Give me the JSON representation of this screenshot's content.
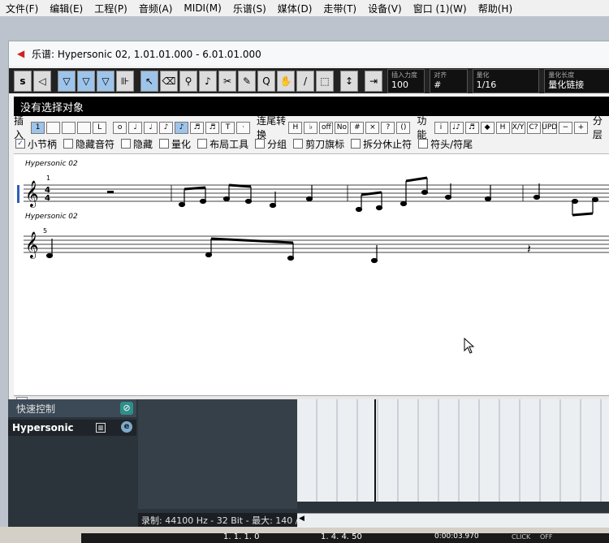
{
  "menubar": {
    "items": [
      "文件(F)",
      "编辑(E)",
      "工程(P)",
      "音频(A)",
      "MIDI(M)",
      "乐谱(S)",
      "媒体(D)",
      "走带(T)",
      "设备(V)",
      "窗口 (1)(W)",
      "帮助(H)"
    ]
  },
  "window": {
    "title": "乐谱: Hypersonic 02, 1.01.01.000 - 6.01.01.000"
  },
  "toolbar": {
    "insert_velocity_label": "插入力度",
    "insert_velocity_value": "100",
    "snap_label": "对齐",
    "quantize_label": "量化",
    "quantize_value": "1/16",
    "quantize_length_label": "量化长度",
    "quantize_length_value": "量化链接"
  },
  "status": {
    "text": "没有选择对象"
  },
  "insert_bar": {
    "insert_label": "插入",
    "insert_buttons": [
      "1",
      "",
      "",
      "",
      "L"
    ],
    "note_buttons": [
      "o",
      "♩",
      "♩",
      "♪",
      "♪",
      "♬",
      "♬",
      "T",
      "·"
    ],
    "beam_label": "连尾转换",
    "beam_buttons": [
      "H",
      "♭",
      "off",
      "No",
      "#",
      "×",
      "?",
      "()"
    ],
    "func_label": "功能",
    "func_buttons": [
      "i",
      "♩♪",
      "♬",
      "◆",
      "H",
      "X/Y",
      "C?",
      "UPD",
      "−",
      "+"
    ],
    "split_label": "分层"
  },
  "filters": [
    {
      "label": "小节柄",
      "checked": true
    },
    {
      "label": "隐藏音符",
      "checked": false
    },
    {
      "label": "隐藏",
      "checked": false
    },
    {
      "label": "量化",
      "checked": false
    },
    {
      "label": "布局工具",
      "checked": false
    },
    {
      "label": "分组",
      "checked": false
    },
    {
      "label": "剪刀旗标",
      "checked": false
    },
    {
      "label": "拆分休止符",
      "checked": false
    },
    {
      "label": "符头/符尾",
      "checked": false
    }
  ],
  "score": {
    "staff1_name": "Hypersonic 02",
    "staff1_bar": "1",
    "time_sig_top": "4",
    "time_sig_bottom": "4",
    "staff2_name": "Hypersonic 02",
    "staff2_bar": "5"
  },
  "bottom": {
    "quick_controls": "快速控制",
    "track_name": "Hypersonic",
    "record_info": "录制: 44100 Hz - 32 Bit - 最大: 140 /"
  },
  "transport": {
    "position_bars": "1. 1. 1.  0",
    "position_time": "1. 4. 4. 50",
    "timecode": "0:00:03.970",
    "click_label": "CLICK",
    "click_value": "OFF"
  },
  "colors": {
    "toolbar_bg": "#222222",
    "selected_tool": "#9ec4ea",
    "track_panel": "#2b333b"
  }
}
